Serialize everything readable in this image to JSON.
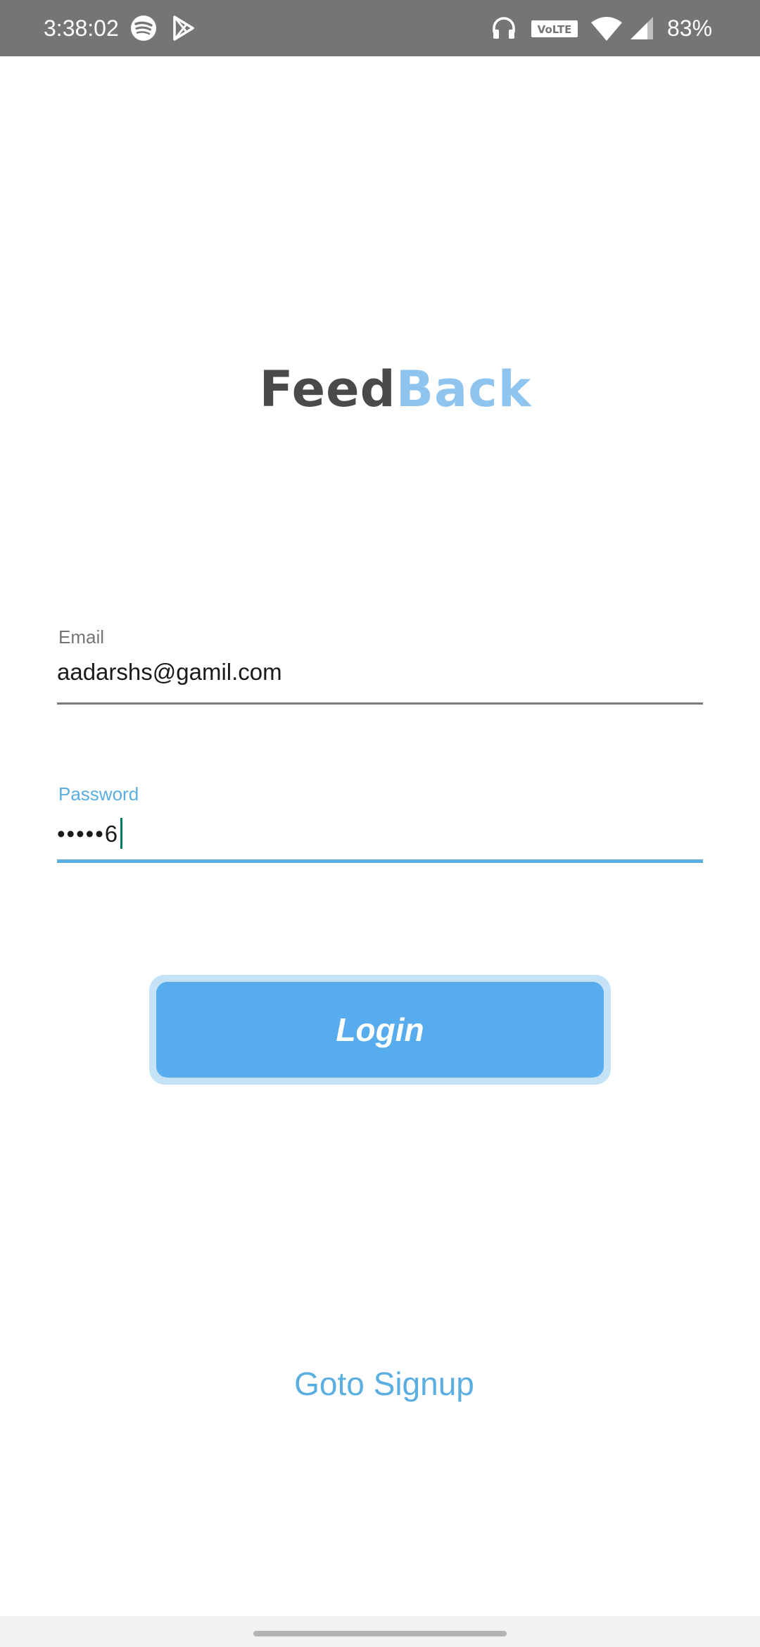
{
  "status_bar": {
    "time": "3:38:02",
    "battery": "83%",
    "icons": [
      "spotify-icon",
      "play-store-icon",
      "headphones-icon",
      "volte-icon",
      "wifi-icon",
      "signal-icon"
    ],
    "volte_label": "VoLTE"
  },
  "logo": {
    "part1": "Feed",
    "part2": "Back",
    "colors": {
      "feed": "#4a4a4a",
      "back": "#8fc4ee"
    }
  },
  "form": {
    "email": {
      "label": "Email",
      "value": "aadarshs@gamil.com"
    },
    "password": {
      "label": "Password",
      "value": "•••••6"
    }
  },
  "login_button": {
    "label": "Login"
  },
  "signup_link": {
    "label": "Goto Signup"
  },
  "colors": {
    "accent": "#5aaee0",
    "button": "#56aced",
    "status_bar": "#757575"
  }
}
